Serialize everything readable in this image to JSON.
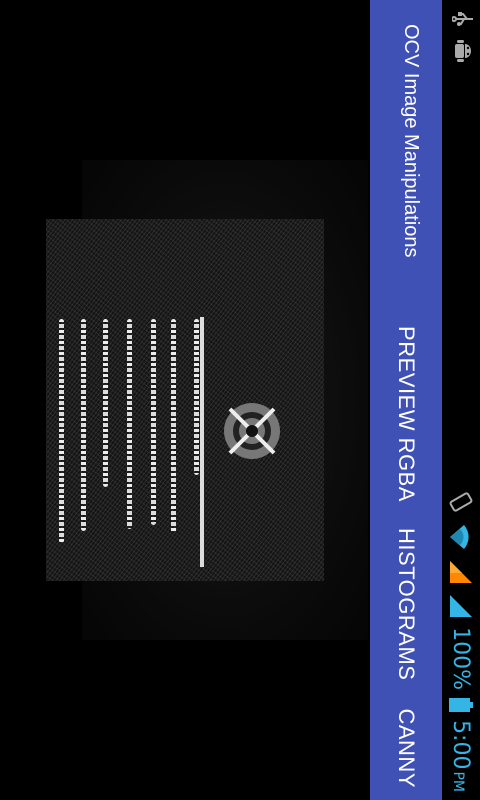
{
  "status_bar": {
    "left_icons": [
      "usb-icon",
      "android-debug-icon"
    ],
    "right_icons": [
      "vibrate-icon",
      "wifi-icon",
      "mobile-signal-icon",
      "signal-icon"
    ],
    "battery_percent": "100%",
    "time": "5:00",
    "time_suffix": "PM",
    "accent_color": "#33b5e5"
  },
  "action_bar": {
    "title": "OCV Image Manipulations",
    "background_color": "#3f51b5",
    "menu": [
      {
        "label": "PREVIEW RGBA"
      },
      {
        "label": "HISTOGRAMS"
      },
      {
        "label": "CANNY"
      }
    ]
  },
  "camera": {
    "mode_shown": "edge-filtered document preview"
  }
}
